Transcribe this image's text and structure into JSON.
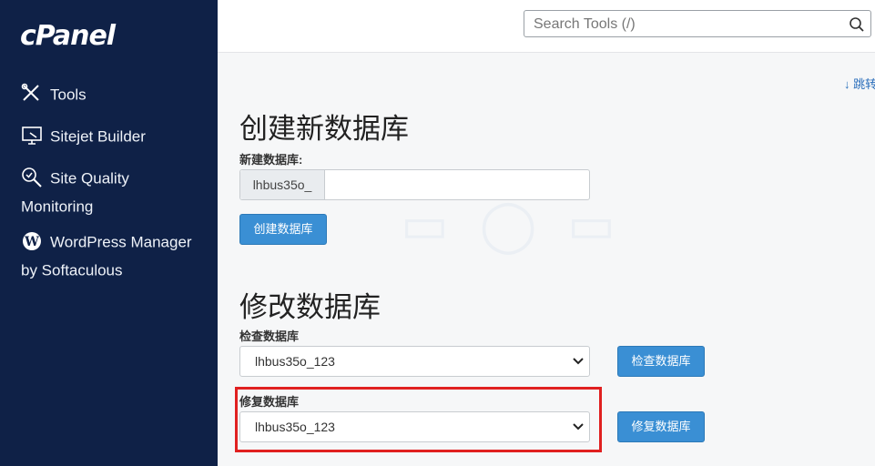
{
  "sidebar": {
    "logo": "cPanel",
    "items": [
      {
        "label": "Tools",
        "icon": "tools-icon"
      },
      {
        "label": "Sitejet Builder",
        "icon": "sitejet-icon"
      },
      {
        "label": "Site Quality",
        "label2": "Monitoring",
        "icon": "site-quality-icon"
      },
      {
        "label": "WordPress Manager",
        "label2": "by Softaculous",
        "icon": "wordpress-icon"
      }
    ]
  },
  "header": {
    "search_placeholder": "Search Tools (/)"
  },
  "main": {
    "jump_link": "↓ 跳转",
    "create_section": {
      "title": "创建新数据库",
      "field_label": "新建数据库:",
      "prefix": "lhbus35o_",
      "input_value": "",
      "button": "创建数据库"
    },
    "modify_section": {
      "title": "修改数据库",
      "check_label": "检查数据库",
      "check_selected": "lhbus35o_123",
      "check_button": "检查数据库",
      "repair_label": "修复数据库",
      "repair_selected": "lhbus35o_123",
      "repair_button": "修复数据库"
    }
  },
  "colors": {
    "sidebar_bg": "#0f2147",
    "button_bg": "#3a8fd4",
    "highlight_border": "#e02020"
  }
}
